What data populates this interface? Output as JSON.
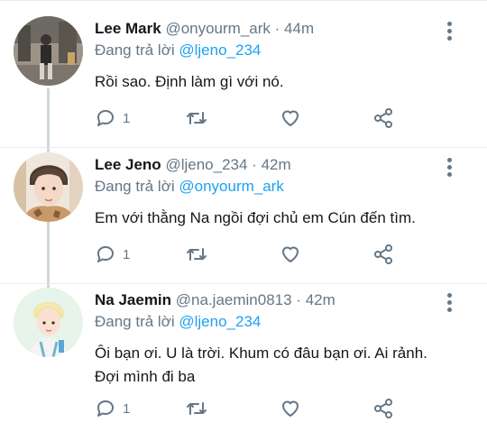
{
  "labels": {
    "reply_prefix": "Đang trả lời"
  },
  "colors": {
    "accent": "#1da1f2",
    "secondary_text": "#657786",
    "thread_line": "#ccd6dd"
  },
  "tweets": [
    {
      "name": "Lee Mark",
      "handle": "@onyourm_ark",
      "dot": "·",
      "time": "44m",
      "reply_to": "@ljeno_234",
      "text": "Rồi sao. Định làm gì với nó.",
      "reply_count": "1",
      "avatar_icon": "street-photo-avatar"
    },
    {
      "name": "Lee Jeno",
      "handle": "@ljeno_234",
      "dot": "·",
      "time": "42m",
      "reply_to": "@onyourm_ark",
      "text": "Em với thằng Na ngồi đợi chủ em Cún đến tìm.",
      "reply_count": "1",
      "avatar_icon": "portrait-avatar"
    },
    {
      "name": "Na Jaemin",
      "handle": "@na.jaemin0813",
      "dot": "·",
      "time": "42m",
      "reply_to": "@ljeno_234",
      "text": "Ôi bạn ơi. U là trời. Khum có đâu bạn ơi. Ai rảnh. Đợi mình đi ba",
      "reply_count": "1",
      "avatar_icon": "illustrated-avatar"
    }
  ]
}
